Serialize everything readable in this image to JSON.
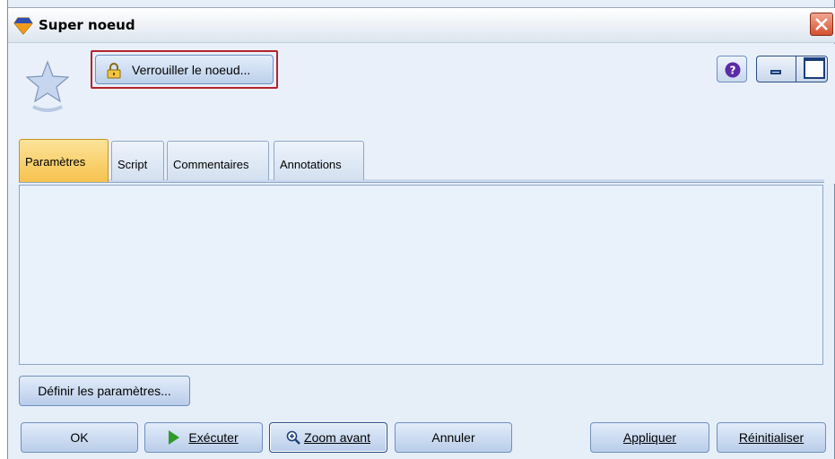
{
  "window": {
    "title": "Super noeud",
    "icon": "super-node-diamond-icon",
    "close_icon": "close-icon"
  },
  "header": {
    "node_icon": "star-icon",
    "lock_button_label": "Verrouiller le noeud...",
    "lock_icon": "padlock-icon",
    "help_icon": "help-icon",
    "minimize_icon": "minimize-icon",
    "maximize_icon": "maximize-icon"
  },
  "tabs": [
    {
      "label": "Paramètres",
      "active": true
    },
    {
      "label": "Script",
      "active": false
    },
    {
      "label": "Commentaires",
      "active": false
    },
    {
      "label": "Annotations",
      "active": false
    }
  ],
  "params_button_label": "Définir les paramètres...",
  "footer": {
    "ok_label": "OK",
    "execute_label": "Exécuter",
    "zoom_label": "Zoom avant",
    "cancel_label": "Annuler",
    "apply_label": "Appliquer",
    "reset_label": "Réinitialiser"
  },
  "colors": {
    "active_tab": "#f6c24d",
    "lock_button_highlight": "#b5232c",
    "close_button": "#d4502f",
    "window_bg": "#e6eef8"
  }
}
